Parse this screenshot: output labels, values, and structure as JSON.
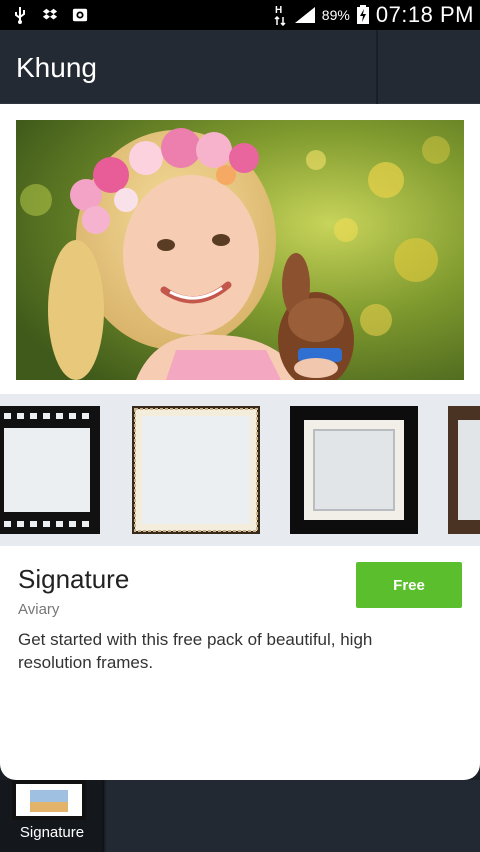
{
  "status_bar": {
    "battery_percent": "89%",
    "time": "07:18 PM",
    "icons": [
      "usb-icon",
      "dropbox-icon",
      "camera-icon",
      "network-hplus-icon",
      "signal-icon",
      "battery-charging-icon"
    ]
  },
  "action_bar": {
    "title": "Khung"
  },
  "pack": {
    "title": "Signature",
    "author": "Aviary",
    "button_label": "Free",
    "description": "Get started with this free pack of beautiful, high resolution frames."
  },
  "frames": [
    "filmstrip-frame",
    "vintage-paper-frame",
    "black-matted-frame",
    "wood-frame"
  ],
  "bottom_bar": {
    "selected_label": "Signature"
  },
  "colors": {
    "accent": "#5bbf2d",
    "action_bar": "#242a33",
    "status_bar": "#000000"
  }
}
